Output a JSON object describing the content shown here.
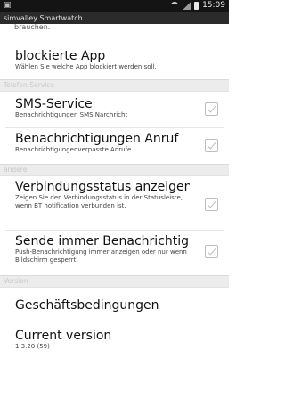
{
  "statusbar": {
    "left_icon": "image-icon",
    "time": "15:09"
  },
  "actionbar": {
    "title": "simvalley Smartwatch"
  },
  "partial_summary": "brauchen.",
  "items": [
    {
      "title": "blockierte App",
      "summary": "Wählen Sie welche App blockiert werden soll."
    }
  ],
  "sections": {
    "telefon": "Telefon-Service",
    "andere": "andere",
    "version": "Version"
  },
  "telefon_items": [
    {
      "title": "SMS-Service",
      "summary": "Benachrichtigungen SMS Narchricht",
      "checked": true
    },
    {
      "title": "Benachrichtigungen Anruf",
      "summary": "Benachrichtigungenverpasste Anrufe",
      "checked": true
    }
  ],
  "andere_items": [
    {
      "title": "Verbindungsstatus anzeigen",
      "summary": "Zeigen Sie den Verbindungsstatus in der Statusleiste, wenn BT notification verbunden ist.",
      "checked": true
    },
    {
      "title": "Sende immer Benachrichtigu",
      "summary": "Push-Benachrichtigung immer anzeigen oder nur wenn Bildschirm gesperrt.",
      "checked": true
    }
  ],
  "version_items": [
    {
      "title": "Geschäftsbedingungen",
      "summary": ""
    },
    {
      "title": "Current version",
      "summary": "1.3.20 (59)"
    }
  ]
}
